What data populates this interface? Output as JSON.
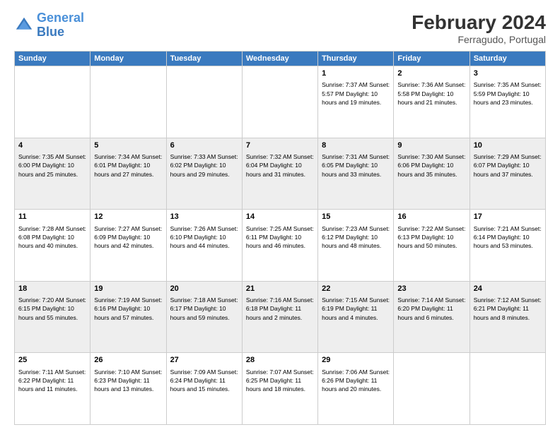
{
  "logo": {
    "text_general": "General",
    "text_blue": "Blue"
  },
  "header": {
    "title": "February 2024",
    "subtitle": "Ferragudo, Portugal"
  },
  "weekdays": [
    "Sunday",
    "Monday",
    "Tuesday",
    "Wednesday",
    "Thursday",
    "Friday",
    "Saturday"
  ],
  "weeks": [
    [
      {
        "day": "",
        "info": ""
      },
      {
        "day": "",
        "info": ""
      },
      {
        "day": "",
        "info": ""
      },
      {
        "day": "",
        "info": ""
      },
      {
        "day": "1",
        "info": "Sunrise: 7:37 AM\nSunset: 5:57 PM\nDaylight: 10 hours\nand 19 minutes."
      },
      {
        "day": "2",
        "info": "Sunrise: 7:36 AM\nSunset: 5:58 PM\nDaylight: 10 hours\nand 21 minutes."
      },
      {
        "day": "3",
        "info": "Sunrise: 7:35 AM\nSunset: 5:59 PM\nDaylight: 10 hours\nand 23 minutes."
      }
    ],
    [
      {
        "day": "4",
        "info": "Sunrise: 7:35 AM\nSunset: 6:00 PM\nDaylight: 10 hours\nand 25 minutes."
      },
      {
        "day": "5",
        "info": "Sunrise: 7:34 AM\nSunset: 6:01 PM\nDaylight: 10 hours\nand 27 minutes."
      },
      {
        "day": "6",
        "info": "Sunrise: 7:33 AM\nSunset: 6:02 PM\nDaylight: 10 hours\nand 29 minutes."
      },
      {
        "day": "7",
        "info": "Sunrise: 7:32 AM\nSunset: 6:04 PM\nDaylight: 10 hours\nand 31 minutes."
      },
      {
        "day": "8",
        "info": "Sunrise: 7:31 AM\nSunset: 6:05 PM\nDaylight: 10 hours\nand 33 minutes."
      },
      {
        "day": "9",
        "info": "Sunrise: 7:30 AM\nSunset: 6:06 PM\nDaylight: 10 hours\nand 35 minutes."
      },
      {
        "day": "10",
        "info": "Sunrise: 7:29 AM\nSunset: 6:07 PM\nDaylight: 10 hours\nand 37 minutes."
      }
    ],
    [
      {
        "day": "11",
        "info": "Sunrise: 7:28 AM\nSunset: 6:08 PM\nDaylight: 10 hours\nand 40 minutes."
      },
      {
        "day": "12",
        "info": "Sunrise: 7:27 AM\nSunset: 6:09 PM\nDaylight: 10 hours\nand 42 minutes."
      },
      {
        "day": "13",
        "info": "Sunrise: 7:26 AM\nSunset: 6:10 PM\nDaylight: 10 hours\nand 44 minutes."
      },
      {
        "day": "14",
        "info": "Sunrise: 7:25 AM\nSunset: 6:11 PM\nDaylight: 10 hours\nand 46 minutes."
      },
      {
        "day": "15",
        "info": "Sunrise: 7:23 AM\nSunset: 6:12 PM\nDaylight: 10 hours\nand 48 minutes."
      },
      {
        "day": "16",
        "info": "Sunrise: 7:22 AM\nSunset: 6:13 PM\nDaylight: 10 hours\nand 50 minutes."
      },
      {
        "day": "17",
        "info": "Sunrise: 7:21 AM\nSunset: 6:14 PM\nDaylight: 10 hours\nand 53 minutes."
      }
    ],
    [
      {
        "day": "18",
        "info": "Sunrise: 7:20 AM\nSunset: 6:15 PM\nDaylight: 10 hours\nand 55 minutes."
      },
      {
        "day": "19",
        "info": "Sunrise: 7:19 AM\nSunset: 6:16 PM\nDaylight: 10 hours\nand 57 minutes."
      },
      {
        "day": "20",
        "info": "Sunrise: 7:18 AM\nSunset: 6:17 PM\nDaylight: 10 hours\nand 59 minutes."
      },
      {
        "day": "21",
        "info": "Sunrise: 7:16 AM\nSunset: 6:18 PM\nDaylight: 11 hours\nand 2 minutes."
      },
      {
        "day": "22",
        "info": "Sunrise: 7:15 AM\nSunset: 6:19 PM\nDaylight: 11 hours\nand 4 minutes."
      },
      {
        "day": "23",
        "info": "Sunrise: 7:14 AM\nSunset: 6:20 PM\nDaylight: 11 hours\nand 6 minutes."
      },
      {
        "day": "24",
        "info": "Sunrise: 7:12 AM\nSunset: 6:21 PM\nDaylight: 11 hours\nand 8 minutes."
      }
    ],
    [
      {
        "day": "25",
        "info": "Sunrise: 7:11 AM\nSunset: 6:22 PM\nDaylight: 11 hours\nand 11 minutes."
      },
      {
        "day": "26",
        "info": "Sunrise: 7:10 AM\nSunset: 6:23 PM\nDaylight: 11 hours\nand 13 minutes."
      },
      {
        "day": "27",
        "info": "Sunrise: 7:09 AM\nSunset: 6:24 PM\nDaylight: 11 hours\nand 15 minutes."
      },
      {
        "day": "28",
        "info": "Sunrise: 7:07 AM\nSunset: 6:25 PM\nDaylight: 11 hours\nand 18 minutes."
      },
      {
        "day": "29",
        "info": "Sunrise: 7:06 AM\nSunset: 6:26 PM\nDaylight: 11 hours\nand 20 minutes."
      },
      {
        "day": "",
        "info": ""
      },
      {
        "day": "",
        "info": ""
      }
    ]
  ]
}
